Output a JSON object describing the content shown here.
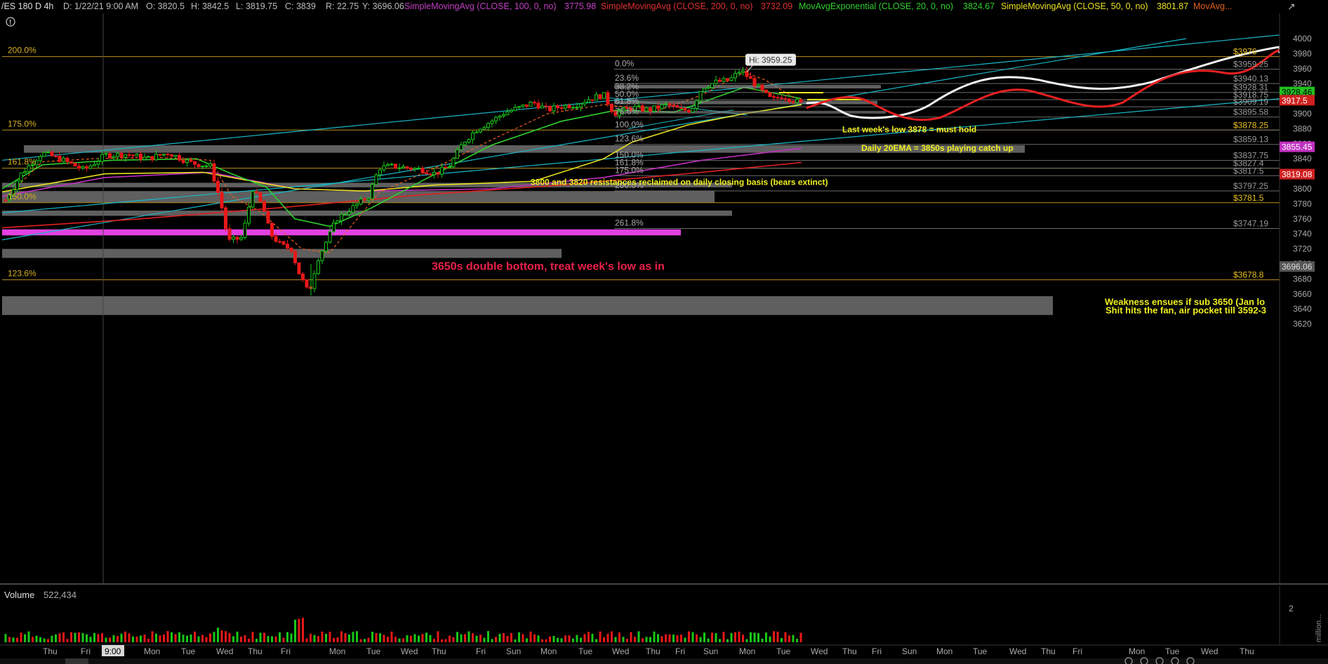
{
  "header": {
    "symbol": "/ES 180 D 4h",
    "date": "D: 1/22/21 9:00 AM",
    "open": "O: 3820.5",
    "high": "H: 3842.5",
    "low": "L: 3819.75",
    "close": "C: 3839",
    "range": "R: 22.75",
    "y": "Y: 3696.06",
    "sma100_label": "SimpleMovingAvg (CLOSE, 100, 0, no)",
    "sma100_value": "3775.98",
    "sma200_label": "SimpleMovingAvg (CLOSE, 200, 0, no)",
    "sma200_value": "3732.09",
    "ema20_label": "MovAvgExponential (CLOSE, 20, 0, no)",
    "ema20_value": "3824.67",
    "sma50_label": "SimpleMovingAvg (CLOSE, 50, 0, no)",
    "sma50_value": "3801.87",
    "more_label": "MovAvg...",
    "colors": {
      "sma100": "#c040c0",
      "sma200": "#e03030",
      "ema20": "#30d030",
      "sma50": "#e8e020",
      "more": "#e06020"
    }
  },
  "chart_data": {
    "type": "candlestick",
    "y_axis_ticks": [
      4000,
      3980,
      3960,
      3940,
      3920,
      3900,
      3880,
      3860,
      3840,
      3820,
      3800,
      3780,
      3760,
      3740,
      3720,
      3700,
      3680,
      3660,
      3640,
      3620
    ],
    "ylim": [
      3610,
      4008
    ],
    "x_axis_labels": [
      "Thu",
      "Fri",
      "9:00",
      "Mon",
      "Tue",
      "Wed",
      "Thu",
      "Fri",
      "Mon",
      "Tue",
      "Wed",
      "Thu",
      "Fri",
      "Sun",
      "Mon",
      "Tue",
      "Wed",
      "Thu",
      "Fri",
      "Sun",
      "Mon",
      "Tue",
      "Wed",
      "Thu",
      "Fri",
      "Sun",
      "Mon",
      "Tue",
      "Wed",
      "Thu",
      "Fri",
      "Mon",
      "Tue",
      "Wed",
      "Thu"
    ],
    "high_marker": "Hi: 3959.25",
    "price_labels": [
      {
        "text": "$3976",
        "value": 3976,
        "color": "#e8c020"
      },
      {
        "text": "$3959.25",
        "value": 3959.25,
        "color": "#999"
      },
      {
        "text": "$3940.13",
        "value": 3940.13,
        "color": "#999"
      },
      {
        "text": "$3928.31",
        "value": 3928.31,
        "color": "#999"
      },
      {
        "text": "$3918.75",
        "value": 3918.75,
        "color": "#999"
      },
      {
        "text": "$3909.19",
        "value": 3909.19,
        "color": "#999"
      },
      {
        "text": "$3895.58",
        "value": 3895.58,
        "color": "#999"
      },
      {
        "text": "$3878.25",
        "value": 3878.25,
        "color": "#e8c020"
      },
      {
        "text": "$3859.13",
        "value": 3859.13,
        "color": "#999"
      },
      {
        "text": "$3837.75",
        "value": 3837.75,
        "color": "#999"
      },
      {
        "text": "$3827.4",
        "value": 3827.4,
        "color": "#999"
      },
      {
        "text": "$3817.5",
        "value": 3817.5,
        "color": "#999"
      },
      {
        "text": "$3797.25",
        "value": 3797.25,
        "color": "#999"
      },
      {
        "text": "$3781.5",
        "value": 3781.5,
        "color": "#e8c020"
      },
      {
        "text": "$3747.19",
        "value": 3747.19,
        "color": "#999"
      },
      {
        "text": "$3678.8",
        "value": 3678.8,
        "color": "#e8c020"
      }
    ],
    "axis_badges": [
      {
        "text": "3928.46",
        "value": 3928.46,
        "color": "#20c020",
        "textcolor": "#000"
      },
      {
        "text": "3917.5",
        "value": 3917.5,
        "color": "#d02020",
        "textcolor": "#fff"
      },
      {
        "text": "3855.45",
        "value": 3855.45,
        "color": "#c030c0",
        "textcolor": "#fff"
      },
      {
        "text": "3819.08",
        "value": 3819.08,
        "color": "#d02020",
        "textcolor": "#fff"
      },
      {
        "text": "3696.06",
        "value": 3696.06,
        "color": "#555",
        "textcolor": "#ddd"
      }
    ],
    "fib_left": [
      {
        "text": "200.0%",
        "value": 3976
      },
      {
        "text": "175.0%",
        "value": 3878.25
      },
      {
        "text": "161.8%",
        "value": 3827.4
      },
      {
        "text": "150.0%",
        "value": 3781.5
      },
      {
        "text": "123.6%",
        "value": 3678.8
      }
    ],
    "fib_right": [
      {
        "text": "0.0%",
        "value": 3959.25
      },
      {
        "text": "23.6%",
        "value": 3940.13
      },
      {
        "text": "38.2%",
        "value": 3928.31
      },
      {
        "text": "50.0%",
        "value": 3918.75
      },
      {
        "text": "61.8%",
        "value": 3909.19
      },
      {
        "text": "78.6%",
        "value": 3895.58
      },
      {
        "text": "100.0%",
        "value": 3878.25
      },
      {
        "text": "123.6%",
        "value": 3859.13
      },
      {
        "text": "150.0%",
        "value": 3837.75
      },
      {
        "text": "161.8%",
        "value": 3827.4
      },
      {
        "text": "175.0%",
        "value": 3817.5
      },
      {
        "text": "200.0%",
        "value": 3797.25
      },
      {
        "text": "261.8%",
        "value": 3747.19
      }
    ],
    "annotations": [
      {
        "text": "Last week's low 3878 = must hold",
        "value": 3879,
        "color": "#f0f020"
      },
      {
        "text": "Daily 20EMA = 3850s playing catch up",
        "value": 3854,
        "color": "#f0f020"
      },
      {
        "text": "3800 and 3820 resistances reclaimed on daily closing basis (bears extinct)",
        "value": 3809,
        "color": "#f0f020"
      },
      {
        "text": "3650s double bottom, treat week's low as in",
        "value": 3696,
        "color": "#e8204a"
      },
      {
        "text": "Weakness ensues if sub 3650 (Jan lo",
        "value": 3649,
        "color": "#f0f020"
      },
      {
        "text": "Shit hits the fan, air pocket till 3592-3",
        "value": 3638,
        "color": "#f0f020"
      }
    ],
    "support_zones": [
      {
        "from": 3848,
        "to": 3858,
        "color": "#777"
      },
      {
        "from": 3802,
        "to": 3808,
        "color": "#777"
      },
      {
        "from": 3782,
        "to": 3797,
        "color": "#777"
      },
      {
        "from": 3764,
        "to": 3771,
        "color": "#777"
      },
      {
        "from": 3738,
        "to": 3746,
        "color": "#ee44ee"
      },
      {
        "from": 3708,
        "to": 3720,
        "color": "#777"
      },
      {
        "from": 3632,
        "to": 3657,
        "color": "#777"
      }
    ]
  },
  "volume": {
    "label": "Volume",
    "value": "522,434",
    "axis_tick": "2",
    "axis_unit": "million..."
  }
}
